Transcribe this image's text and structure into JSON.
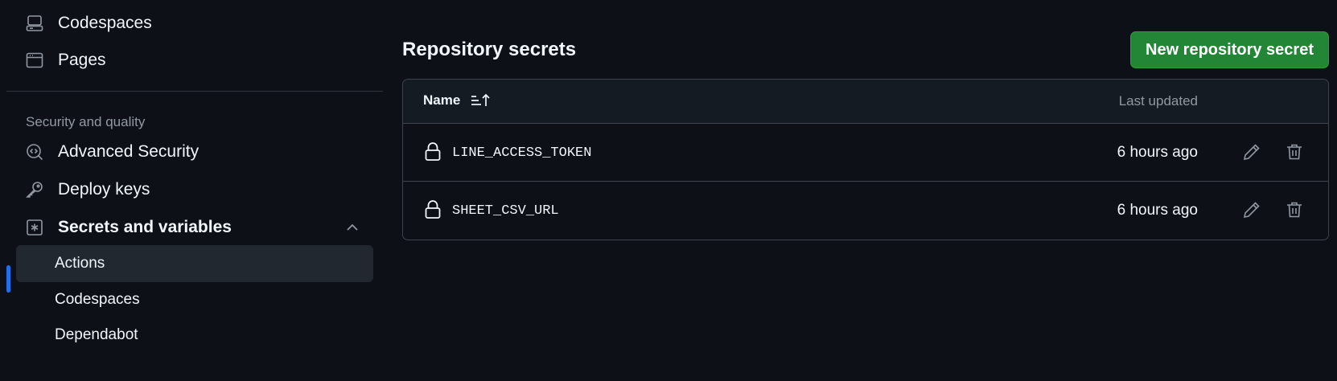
{
  "sidebar": {
    "items": [
      {
        "label": "Codespaces",
        "icon": "codespaces-icon"
      },
      {
        "label": "Pages",
        "icon": "browser-icon"
      }
    ],
    "section_heading": "Security and quality",
    "security_items": [
      {
        "label": "Advanced Security",
        "icon": "codescan-icon"
      },
      {
        "label": "Deploy keys",
        "icon": "key-icon"
      },
      {
        "label": "Secrets and variables",
        "icon": "asterisk-icon",
        "expanded": true
      }
    ],
    "sub_items": [
      {
        "label": "Actions",
        "active": true
      },
      {
        "label": "Codespaces",
        "active": false
      },
      {
        "label": "Dependabot",
        "active": false
      }
    ]
  },
  "main": {
    "title": "Repository secrets",
    "new_button_label": "New repository secret",
    "table": {
      "header_name": "Name",
      "header_updated": "Last updated",
      "rows": [
        {
          "name": "LINE_ACCESS_TOKEN",
          "updated": "6 hours ago"
        },
        {
          "name": "SHEET_CSV_URL",
          "updated": "6 hours ago"
        }
      ]
    }
  },
  "colors": {
    "background": "#0d1117",
    "accent_green": "#238636",
    "active_bar": "#1f6feb",
    "muted_text": "#9198a1",
    "border": "#3d444d"
  }
}
